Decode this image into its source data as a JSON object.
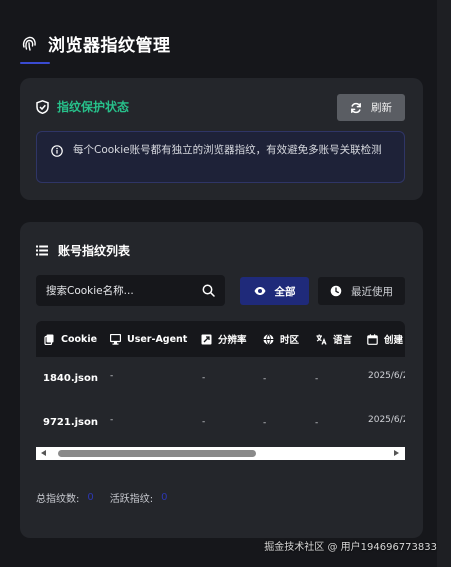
{
  "header": {
    "title": "浏览器指纹管理",
    "logo_icon": "fingerprint-icon"
  },
  "status_card": {
    "title": "指纹保护状态",
    "refresh_label": "刷新",
    "info_text": "每个Cookie账号都有独立的浏览器指纹，有效避免多账号关联检测"
  },
  "list_card": {
    "title": "账号指纹列表",
    "search_placeholder": "搜索Cookie名称...",
    "filter_all_label": "全部",
    "filter_recent_label": "最近使用",
    "columns": [
      "Cookie",
      "User-Agent",
      "分辨率",
      "时区",
      "语言",
      "创建"
    ],
    "rows": [
      {
        "name": "1840.json",
        "ua": "-",
        "resolution": "-",
        "timezone": "-",
        "language": "-",
        "created": "2025/6/2"
      },
      {
        "name": "9721.json",
        "ua": "-",
        "resolution": "-",
        "timezone": "-",
        "language": "-",
        "created": "2025/6/2"
      }
    ],
    "stats": {
      "total_label": "总指纹数:",
      "total_value": "0",
      "active_label": "活跃指纹:",
      "active_value": "0"
    }
  },
  "watermark": "掘金技术社区 @ 用户194696773833",
  "colors": {
    "accent": "#27c08a",
    "primary": "#1f2a7a",
    "card": "#24262b",
    "background": "#16171b"
  }
}
